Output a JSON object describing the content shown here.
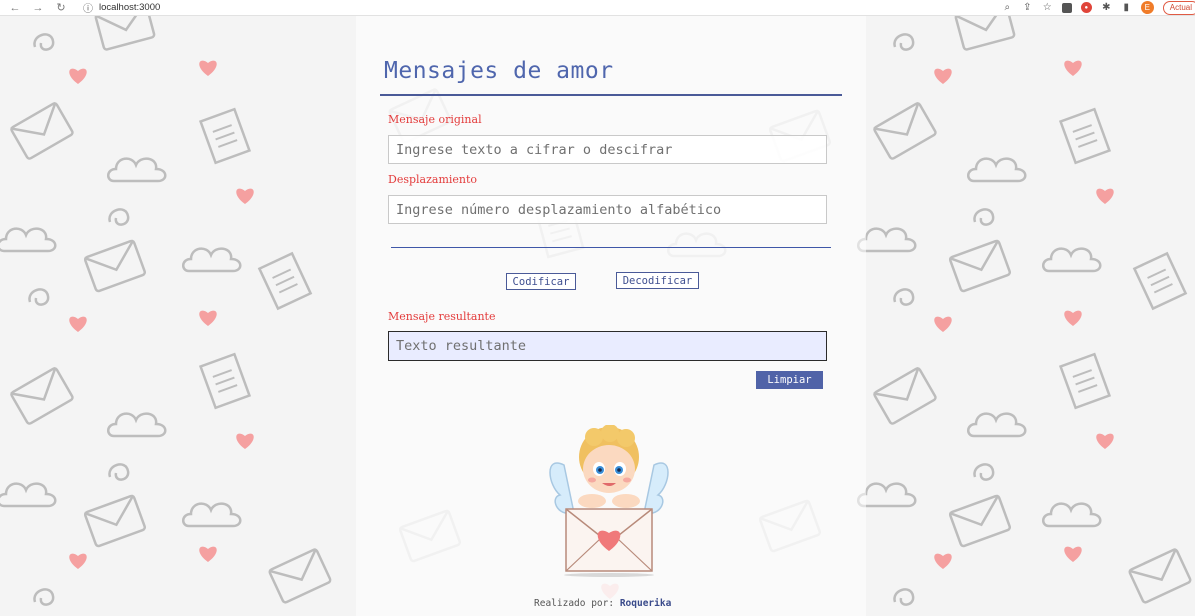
{
  "browser": {
    "url": "localhost:3000",
    "update_label": "Actual",
    "avatar_letter": "E"
  },
  "app": {
    "title": "Mensajes de amor",
    "original_label": "Mensaje original",
    "original_placeholder": "Ingrese texto a cifrar o descifrar",
    "shift_label": "Desplazamiento",
    "shift_placeholder": "Ingrese número desplazamiento alfabético",
    "encode_button": "Codificar",
    "decode_button": "Decodificar",
    "result_label": "Mensaje resultante",
    "result_placeholder": "Texto resultante",
    "clear_button": "Limpiar",
    "footer_prefix": "Realizado por:",
    "footer_author": "Roquerika"
  },
  "colors": {
    "accent": "#4f66ad",
    "label_red": "#e33c3c",
    "heart": "#f0797a"
  }
}
